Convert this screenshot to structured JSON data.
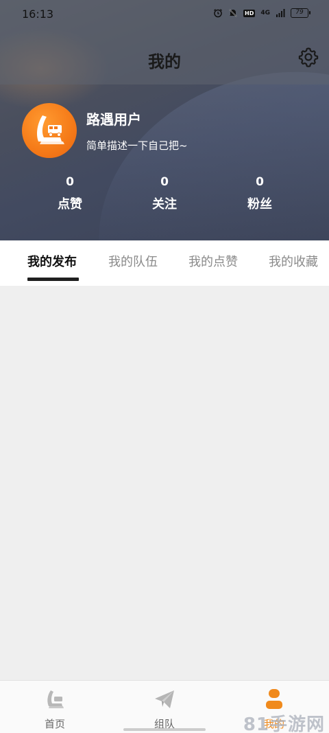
{
  "status_bar": {
    "time": "16:13",
    "network": "4G",
    "battery": "79"
  },
  "header": {
    "title": "我的"
  },
  "profile": {
    "name": "路遇用户",
    "description": "简单描述一下自己把~"
  },
  "stats": [
    {
      "value": "0",
      "label": "点赞"
    },
    {
      "value": "0",
      "label": "关注"
    },
    {
      "value": "0",
      "label": "粉丝"
    }
  ],
  "tabs": [
    {
      "label": "我的发布",
      "active": true
    },
    {
      "label": "我的队伍",
      "active": false
    },
    {
      "label": "我的点赞",
      "active": false
    },
    {
      "label": "我的收藏",
      "active": false
    }
  ],
  "bottom_nav": [
    {
      "label": "首页",
      "icon": "home-logo-icon",
      "active": false
    },
    {
      "label": "组队",
      "icon": "paper-plane-icon",
      "active": false
    },
    {
      "label": "我的",
      "icon": "user-icon",
      "active": true
    }
  ],
  "watermark": "81手游网",
  "colors": {
    "accent": "#f08a1c",
    "avatar": "#f57a18",
    "hero": "#454b5c"
  }
}
